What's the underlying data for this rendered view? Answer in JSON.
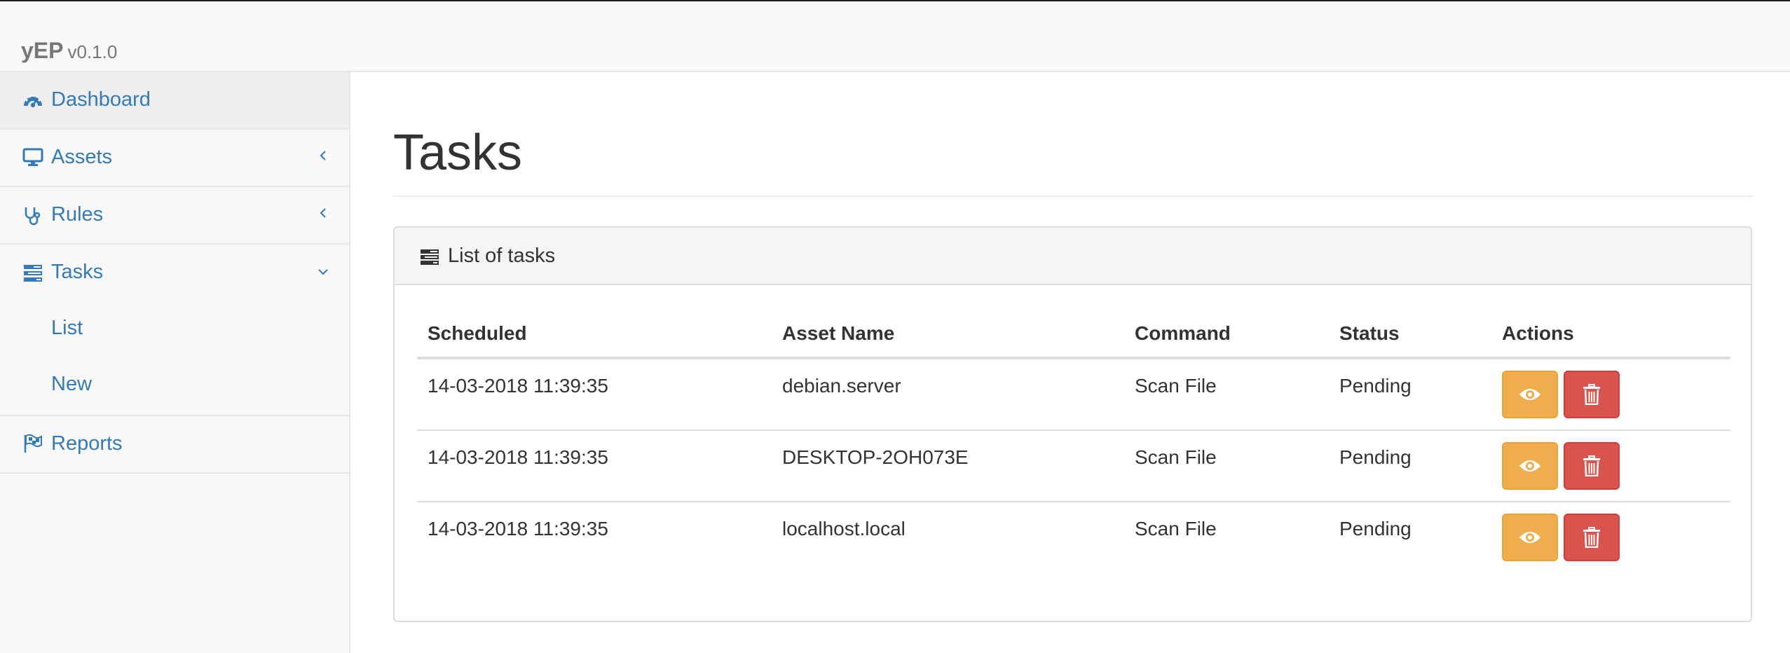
{
  "brand": {
    "name": "yEP",
    "version": "v0.1.0"
  },
  "sidebar": {
    "items": [
      {
        "label": "Dashboard",
        "icon": "dashboard-icon",
        "active": true
      },
      {
        "label": "Assets",
        "icon": "desktop-icon",
        "chevron": "chevron-left-icon"
      },
      {
        "label": "Rules",
        "icon": "stethoscope-icon",
        "chevron": "chevron-left-icon"
      },
      {
        "label": "Tasks",
        "icon": "tasks-icon",
        "chevron": "chevron-down-icon",
        "children": [
          {
            "label": "List"
          },
          {
            "label": "New"
          }
        ]
      },
      {
        "label": "Reports",
        "icon": "flag-checkered-icon"
      }
    ]
  },
  "main": {
    "title": "Tasks",
    "panel": {
      "heading": "List of tasks",
      "heading_icon": "tasks-icon",
      "columns": [
        "Scheduled",
        "Asset Name",
        "Command",
        "Status",
        "Actions"
      ],
      "rows": [
        {
          "scheduled": "14-03-2018 11:39:35",
          "asset": "debian.server",
          "command": "Scan File",
          "status": "Pending"
        },
        {
          "scheduled": "14-03-2018 11:39:35",
          "asset": "DESKTOP-2OH073E",
          "command": "Scan File",
          "status": "Pending"
        },
        {
          "scheduled": "14-03-2018 11:39:35",
          "asset": "localhost.local",
          "command": "Scan File",
          "status": "Pending"
        }
      ],
      "actions": [
        {
          "name": "view",
          "icon": "eye-icon",
          "color": "#f0ad4e"
        },
        {
          "name": "delete",
          "icon": "trash-icon",
          "color": "#d9534f"
        }
      ]
    }
  },
  "colors": {
    "link": "#337ab7",
    "warning": "#f0ad4e",
    "danger": "#d9534f",
    "sidebar_bg": "#f8f8f8",
    "active_bg": "#eeeeee"
  }
}
